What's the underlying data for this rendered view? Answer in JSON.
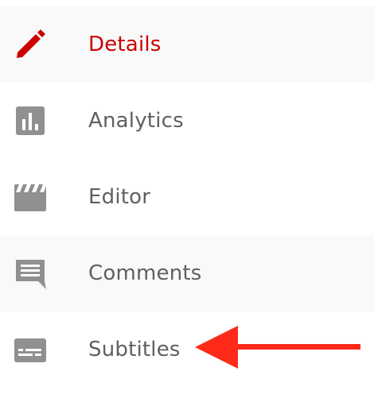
{
  "menu": {
    "items": [
      {
        "label": "Details",
        "icon": "pencil-icon",
        "active": true
      },
      {
        "label": "Analytics",
        "icon": "bar-chart-icon",
        "active": false
      },
      {
        "label": "Editor",
        "icon": "clapperboard-icon",
        "active": false
      },
      {
        "label": "Comments",
        "icon": "comment-icon",
        "active": false
      },
      {
        "label": "Subtitles",
        "icon": "subtitles-icon",
        "active": false
      }
    ]
  },
  "colors": {
    "active": "#cc0000",
    "text": "#606060",
    "icon": "#909090",
    "shaded_row": "#f9f9f9",
    "annotation_arrow": "#ff2a1a"
  }
}
